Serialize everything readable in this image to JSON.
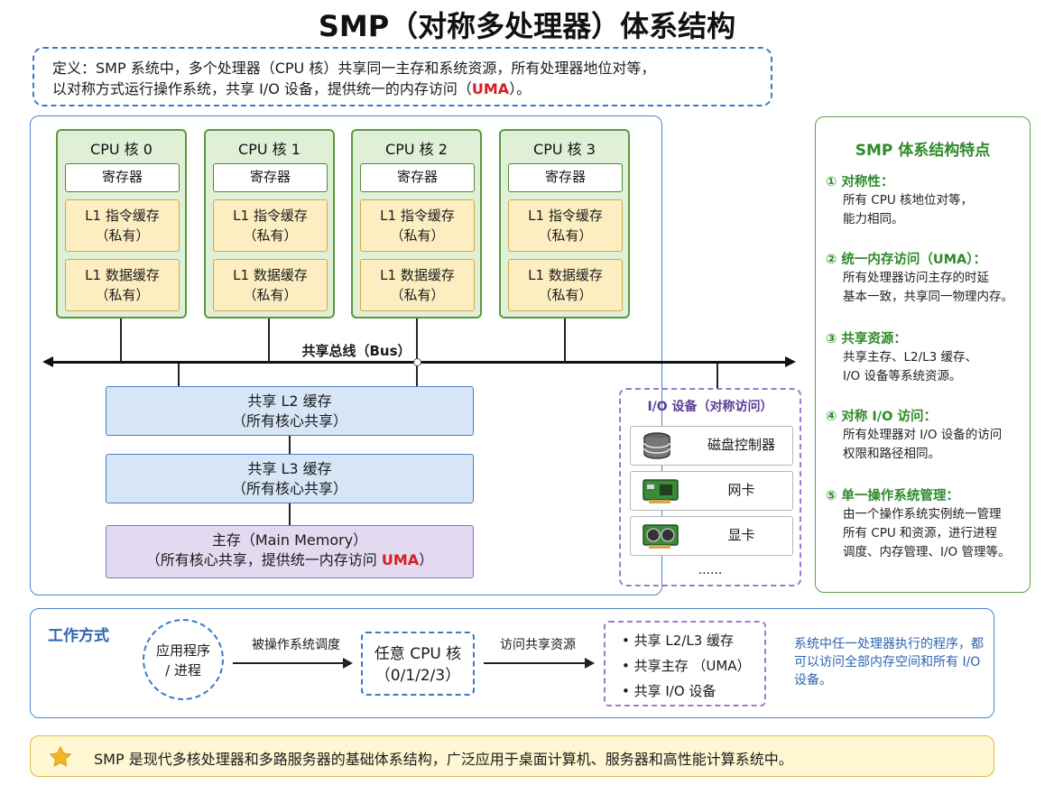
{
  "title": "SMP（对称多处理器）体系结构",
  "definition": {
    "text_part1": "定义：SMP 系统中，多个处理器（CPU 核）共享同一主存和系统资源，所有处理器地位对等，",
    "text_part2": "以对称方式运行操作系统，共享 I/O 设备，提供统一的内存访问（",
    "uma": "UMA",
    "text_part3": "）。"
  },
  "cpus": [
    {
      "name": "CPU 核 0",
      "register": "寄存器",
      "l1i": "L1 指令缓存",
      "l1d": "L1 数据缓存",
      "private": "（私有）"
    },
    {
      "name": "CPU 核 1",
      "register": "寄存器",
      "l1i": "L1 指令缓存",
      "l1d": "L1 数据缓存",
      "private": "（私有）"
    },
    {
      "name": "CPU 核 2",
      "register": "寄存器",
      "l1i": "L1 指令缓存",
      "l1d": "L1 数据缓存",
      "private": "（私有）"
    },
    {
      "name": "CPU 核 3",
      "register": "寄存器",
      "l1i": "L1 指令缓存",
      "l1d": "L1 数据缓存",
      "private": "（私有）"
    }
  ],
  "bus": {
    "label": "共享总线（Bus）"
  },
  "shared": {
    "l2_title": "共享 L2 缓存",
    "l2_sub": "（所有核心共享）",
    "l3_title": "共享 L3 缓存",
    "l3_sub": "（所有核心共享）",
    "mem_title": "主存（Main Memory）",
    "mem_sub": "（所有核心共享，提供统一内存访问",
    "mem_uma": "UMA",
    "mem_close": "）"
  },
  "io": {
    "title": "I/O 设备（对称访问）",
    "items": [
      "磁盘控制器",
      "网卡",
      "显卡"
    ],
    "more": "......"
  },
  "features": {
    "title": "SMP 体系结构特点",
    "items": [
      {
        "head": "① 对称性：",
        "line1": "所有 CPU 核地位对等，",
        "line2": "能力相同。"
      },
      {
        "head": "② 统一内存访问（UMA）：",
        "line1": "所有处理器访问主存的时延",
        "line2": "基本一致，共享同一物理内存。"
      },
      {
        "head": "③ 共享资源：",
        "line1": "共享主存、L2/L3 缓存、",
        "line2": "I/O 设备等系统资源。"
      },
      {
        "head": "④ 对称 I/O 访问：",
        "line1": "所有处理器对 I/O 设备的访问",
        "line2": "权限和路径相同。"
      },
      {
        "head": "⑤ 单一操作系统管理：",
        "line1": "由一个操作系统实例统一管理",
        "line2": "所有 CPU 和资源，进行进程",
        "line3": "调度、内存管理、I/O 管理等。"
      }
    ]
  },
  "work": {
    "title": "工作方式",
    "process_line1": "应用程序",
    "process_line2": "/ 进程",
    "arrow1": "被操作系统调度",
    "cpu_line1": "任意 CPU 核",
    "cpu_line2": "（0/1/2/3）",
    "arrow2": "访问共享资源",
    "resources": [
      "• 共享 L2/L3 缓存",
      "• 共享主存 （UMA）",
      "• 共享 I/O 设备"
    ],
    "note": "系统中任一处理器执行的程序，都可以访问全部内存空间和所有 I/O 设备。"
  },
  "footer": {
    "text": "SMP 是现代多核处理器和多路服务器的基础体系结构，广泛应用于桌面计算机、服务器和高性能计算系统中。"
  },
  "colors": {
    "cpu_fill": "#dff0d6",
    "cache_fill": "#fdeec2",
    "shared_fill": "#d6e6f7",
    "memory_fill": "#e3daf1",
    "accent_blue": "#2d64ae",
    "accent_green": "#2f8a2a",
    "uma_red": "#d81e1e"
  }
}
